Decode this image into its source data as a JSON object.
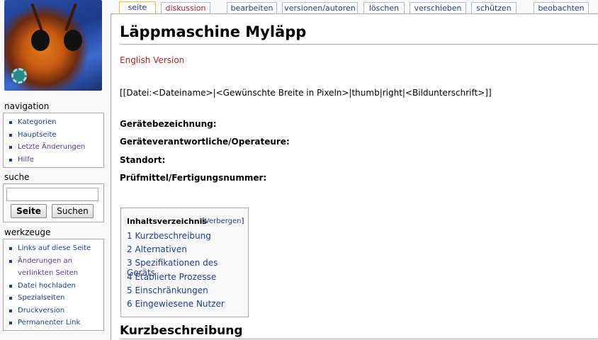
{
  "tabs": [
    {
      "label": "seite",
      "selected": true,
      "new": false
    },
    {
      "label": "diskussion",
      "selected": false,
      "new": true
    },
    {
      "label": "bearbeiten",
      "selected": false,
      "new": false
    },
    {
      "label": "versionen/autoren",
      "selected": false,
      "new": false
    },
    {
      "label": "löschen",
      "selected": false,
      "new": false
    },
    {
      "label": "verschieben",
      "selected": false,
      "new": false
    },
    {
      "label": "schützen",
      "selected": false,
      "new": false
    },
    {
      "label": "beobachten",
      "selected": false,
      "new": false
    }
  ],
  "sidebar": {
    "navigation": {
      "heading": "navigation",
      "items": [
        "Kategorien",
        "Hauptseite",
        "Letzte Änderungen",
        "Hilfe"
      ]
    },
    "search": {
      "heading": "suche",
      "input_value": "",
      "go_label": "Seite",
      "search_label": "Suchen"
    },
    "toolbox": {
      "heading": "werkzeuge",
      "items": [
        "Links auf diese Seite",
        "Änderungen an",
        "verlinkten Seiten",
        "Datei hochladen",
        "Spezialseiten",
        "Druckversion",
        "Permanenter Link"
      ]
    }
  },
  "page": {
    "title": "Läppmaschine Myläpp",
    "english_link": "English Version",
    "datei_text": "[[Datei:<Dateiname>|<Gewünschte Breite in Pixeln>|thumb|right|<Bildunterschrift>]]",
    "fields": [
      "Gerätebezeichnung:",
      "Geräteverantwortliche/Operateure:",
      "Standort:",
      "Prüfmittel/Fertigungsnummer:"
    ],
    "toc": {
      "title": "Inhaltsverzeichnis",
      "toggle_open": "[",
      "toggle_label": "Verbergen",
      "toggle_close": "]",
      "items": [
        "1 Kurzbeschreibung",
        "2 Alternativen",
        "3 Spezifikationen des Geräts",
        "4 Etablierte Prozesse",
        "5 Einschränkungen",
        "6 Eingewiesene Nutzer"
      ]
    },
    "section_heading": "Kurzbeschreibung"
  },
  "colors": {
    "link": "#1c3d9a",
    "new_link": "#ba2020",
    "selected_tab_border": "#fabd23"
  }
}
